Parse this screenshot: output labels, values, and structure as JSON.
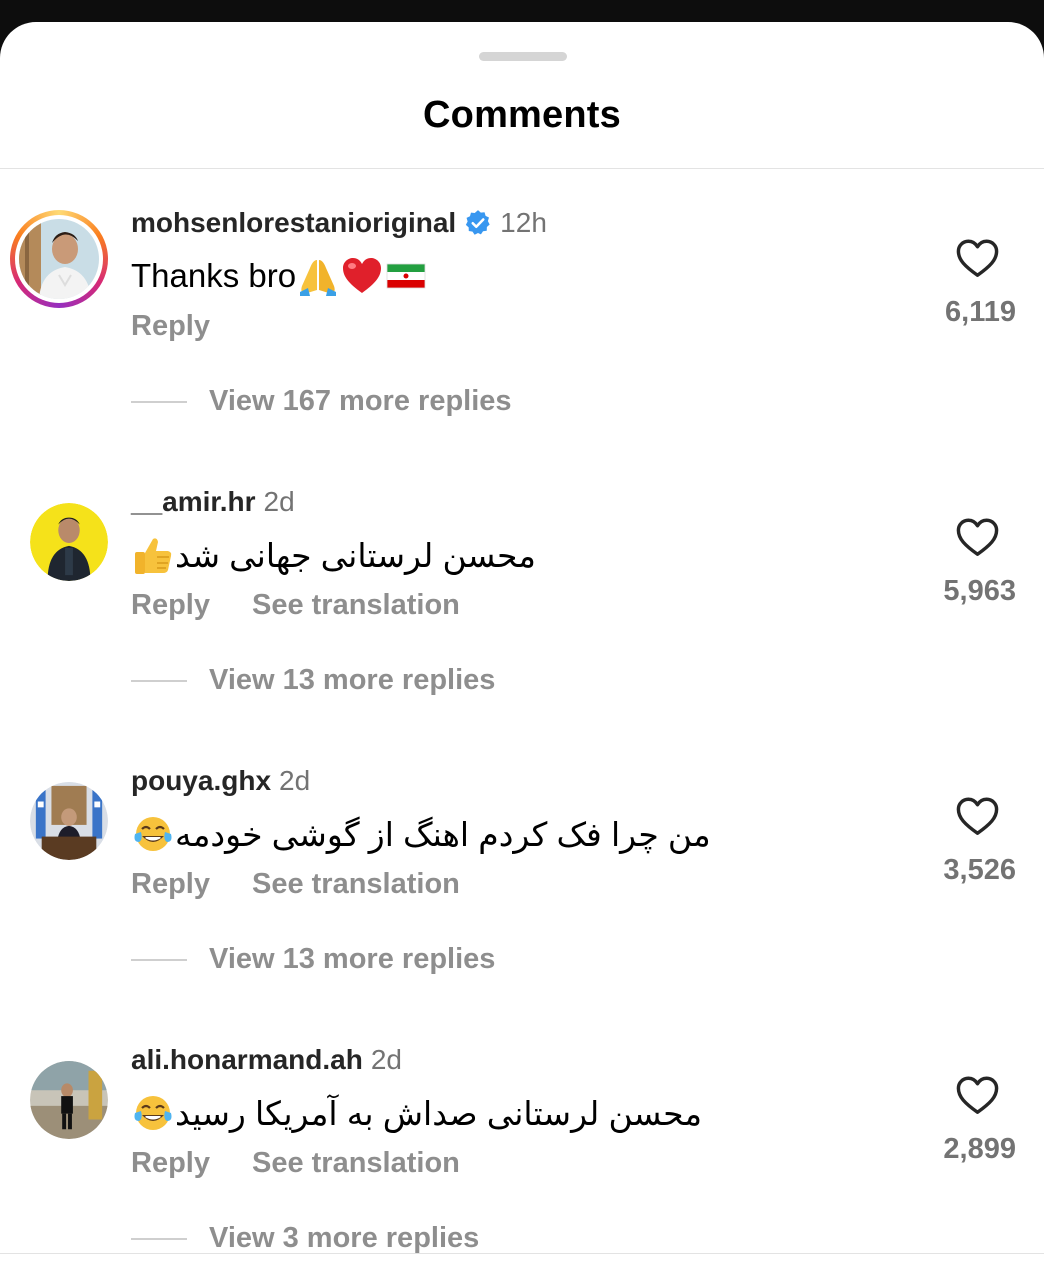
{
  "header": {
    "title": "Comments"
  },
  "comments": [
    {
      "username": "mohsenlorestanioriginal",
      "verified": true,
      "time": "12h",
      "text": "Thanks bro",
      "text_emojis": [
        "folded-hands",
        "red-heart",
        "iran-flag"
      ],
      "reply_label": "Reply",
      "translation_label": "",
      "likes": "6,119",
      "more_replies": "View 167 more replies"
    },
    {
      "username": "__amir.hr",
      "verified": false,
      "time": "2d",
      "text": "محسن لرستانی جهانی شد",
      "text_emojis": [
        "thumbs-up"
      ],
      "reply_label": "Reply",
      "translation_label": "See translation",
      "likes": "5,963",
      "more_replies": "View 13 more replies"
    },
    {
      "username": "pouya.ghx",
      "verified": false,
      "time": "2d",
      "text": "من چرا فک کردم اهنگ از گوشی خودمه",
      "text_emojis": [
        "tears-of-joy"
      ],
      "reply_label": "Reply",
      "translation_label": "See translation",
      "likes": "3,526",
      "more_replies": "View 13 more replies"
    },
    {
      "username": "ali.honarmand.ah",
      "verified": false,
      "time": "2d",
      "text": "محسن لرستانی صداش به آمریکا رسید",
      "text_emojis": [
        "tears-of-joy"
      ],
      "reply_label": "Reply",
      "translation_label": "See translation",
      "likes": "2,899",
      "more_replies": "View 3 more replies"
    }
  ],
  "colors": {
    "verified_badge": "#3897f0",
    "secondary_text": "#8e8e8e",
    "heart_outline": "#262626"
  }
}
